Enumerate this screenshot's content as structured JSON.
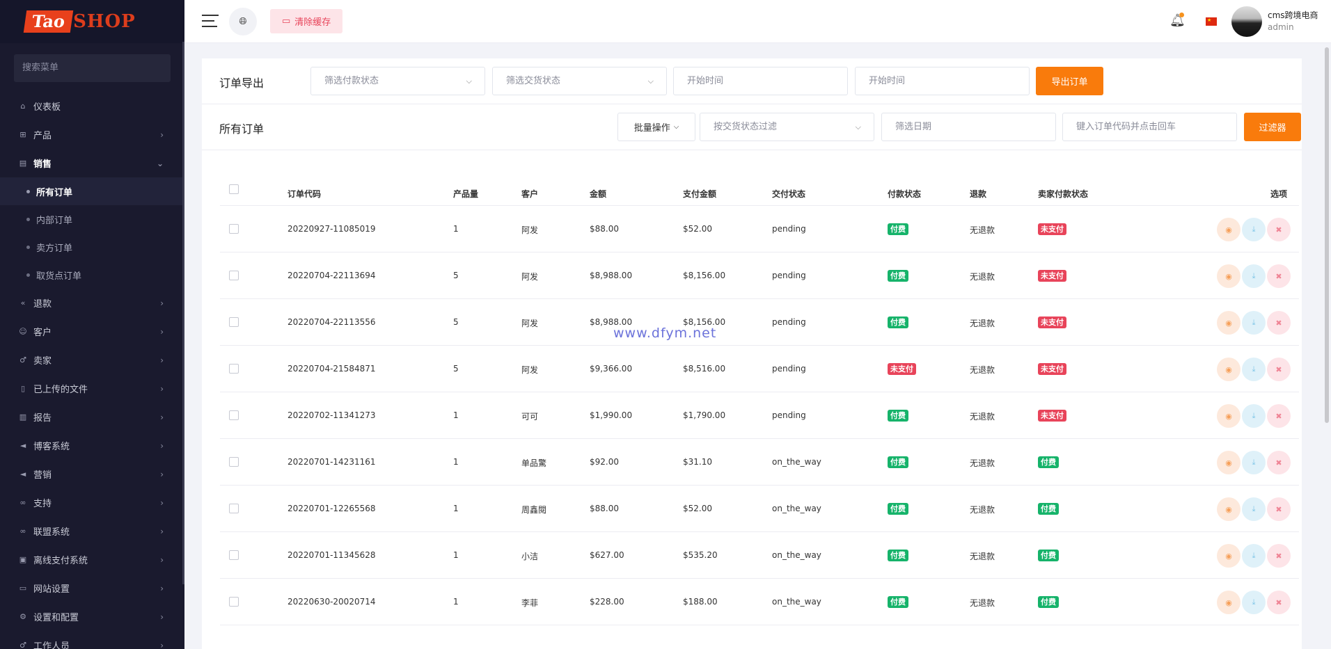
{
  "sidebar": {
    "logo_part1": "Tao",
    "logo_part2": "SHOP",
    "search_placeholder": "搜索菜单",
    "menu": [
      {
        "label": "仪表板",
        "icon": "home-icon",
        "has_children": false
      },
      {
        "label": "产品",
        "icon": "cart-icon",
        "has_children": true
      },
      {
        "label": "销售",
        "icon": "card-icon",
        "has_children": true,
        "expanded": true
      }
    ],
    "sales_children": [
      {
        "label": "所有订单",
        "active": true
      },
      {
        "label": "内部订单",
        "active": false
      },
      {
        "label": "卖方订单",
        "active": false
      },
      {
        "label": "取货点订单",
        "active": false
      }
    ],
    "menu_after": [
      {
        "label": "退款",
        "icon": "backward-icon"
      },
      {
        "label": "客户",
        "icon": "users-icon"
      },
      {
        "label": "卖家",
        "icon": "user-icon"
      },
      {
        "label": "已上传的文件",
        "icon": "file-icon"
      },
      {
        "label": "报告",
        "icon": "report-icon"
      },
      {
        "label": "博客系统",
        "icon": "megaphone-icon"
      },
      {
        "label": "营销",
        "icon": "bullhorn-icon"
      },
      {
        "label": "支持",
        "icon": "link-icon"
      },
      {
        "label": "联盟系统",
        "icon": "link-icon"
      },
      {
        "label": "离线支付系统",
        "icon": "money-icon"
      },
      {
        "label": "网站设置",
        "icon": "desktop-icon"
      },
      {
        "label": "设置和配置",
        "icon": "gear-icon"
      },
      {
        "label": "工作人员",
        "icon": "staff-icon"
      }
    ]
  },
  "topbar": {
    "clear_cache": "清除缓存",
    "user_name": "cms跨境电商",
    "user_role": "admin"
  },
  "export": {
    "title": "订单导出",
    "payment_status_placeholder": "筛选付款状态",
    "delivery_status_placeholder": "筛选交货状态",
    "start_time_placeholder": "开始时间",
    "start_time2_placeholder": "开始时间",
    "export_button": "导出订单"
  },
  "orders": {
    "title": "所有订单",
    "bulk_action": "批量操作",
    "delivery_filter_placeholder": "按交货状态过滤",
    "date_filter_placeholder": "筛选日期",
    "code_search_placeholder": "键入订单代码并点击回车",
    "filter_button": "过滤器"
  },
  "table": {
    "headers": {
      "code": "订单代码",
      "qty": "产品量",
      "customer": "客户",
      "amount": "金额",
      "paid": "支付金额",
      "delivery": "交付状态",
      "payment": "付款状态",
      "refund": "退款",
      "seller_payment": "卖家付款状态",
      "options": "选项"
    },
    "rows": [
      {
        "code": "20220927-11085019",
        "qty": "1",
        "customer": "阿发",
        "amount": "$88.00",
        "paid": "$52.00",
        "delivery": "pending",
        "payment": "付费",
        "payment_color": "green",
        "refund": "无退款",
        "seller_payment": "未支付",
        "seller_color": "red"
      },
      {
        "code": "20220704-22113694",
        "qty": "5",
        "customer": "阿发",
        "amount": "$8,988.00",
        "paid": "$8,156.00",
        "delivery": "pending",
        "payment": "付费",
        "payment_color": "green",
        "refund": "无退款",
        "seller_payment": "未支付",
        "seller_color": "red"
      },
      {
        "code": "20220704-22113556",
        "qty": "5",
        "customer": "阿发",
        "amount": "$8,988.00",
        "paid": "$8,156.00",
        "delivery": "pending",
        "payment": "付费",
        "payment_color": "green",
        "refund": "无退款",
        "seller_payment": "未支付",
        "seller_color": "red"
      },
      {
        "code": "20220704-21584871",
        "qty": "5",
        "customer": "阿发",
        "amount": "$9,366.00",
        "paid": "$8,516.00",
        "delivery": "pending",
        "payment": "未支付",
        "payment_color": "red",
        "refund": "无退款",
        "seller_payment": "未支付",
        "seller_color": "red"
      },
      {
        "code": "20220702-11341273",
        "qty": "1",
        "customer": "可可",
        "amount": "$1,990.00",
        "paid": "$1,790.00",
        "delivery": "pending",
        "payment": "付费",
        "payment_color": "green",
        "refund": "无退款",
        "seller_payment": "未支付",
        "seller_color": "red"
      },
      {
        "code": "20220701-14231161",
        "qty": "1",
        "customer": "单品驚",
        "amount": "$92.00",
        "paid": "$31.10",
        "delivery": "on_the_way",
        "payment": "付费",
        "payment_color": "green",
        "refund": "无退款",
        "seller_payment": "付费",
        "seller_color": "green"
      },
      {
        "code": "20220701-12265568",
        "qty": "1",
        "customer": "周鑫閱",
        "amount": "$88.00",
        "paid": "$52.00",
        "delivery": "on_the_way",
        "payment": "付费",
        "payment_color": "green",
        "refund": "无退款",
        "seller_payment": "付费",
        "seller_color": "green"
      },
      {
        "code": "20220701-11345628",
        "qty": "1",
        "customer": "小洁",
        "amount": "$627.00",
        "paid": "$535.20",
        "delivery": "on_the_way",
        "payment": "付费",
        "payment_color": "green",
        "refund": "无退款",
        "seller_payment": "付费",
        "seller_color": "green"
      },
      {
        "code": "20220630-20020714",
        "qty": "1",
        "customer": "李菲",
        "amount": "$228.00",
        "paid": "$188.00",
        "delivery": "on_the_way",
        "payment": "付费",
        "payment_color": "green",
        "refund": "无退款",
        "seller_payment": "付费",
        "seller_color": "green"
      }
    ]
  },
  "watermark": "www.dfym.net"
}
